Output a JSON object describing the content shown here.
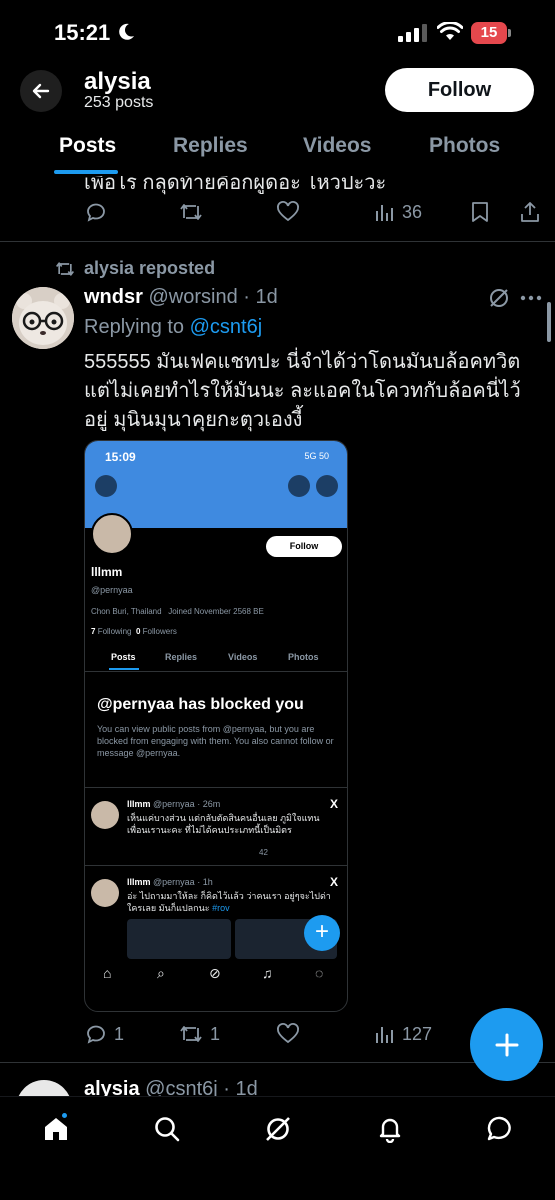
{
  "status_bar": {
    "time": "15:21",
    "battery": "15"
  },
  "header": {
    "name": "alysia",
    "post_count": "253 posts",
    "follow_label": "Follow"
  },
  "tabs": [
    "Posts",
    "Replies",
    "Videos",
    "Photos"
  ],
  "prev_post": {
    "text_fragment": "เพื่อไร กลุดท้ายคือกผูดอะ ไหวปะวะ",
    "views": "36"
  },
  "post": {
    "repost_label": "alysia reposted",
    "display_name": "wndsr",
    "handle_time": "@worsind · 1d",
    "replying_prefix": "Replying to ",
    "replying_mention": "@csnt6j",
    "text": "555555 มันเฟคแชทปะ นี่จำได้ว่าโดนมันบล้อคทวิตแต่ไม่เคยทำไรให้มันนะ ละแอคในโควทกับล้อคนี่ไว้อยู่ มุนินมุนาคุยกะตุวเองงี้",
    "replies": "1",
    "reposts": "1",
    "views": "127"
  },
  "embedded": {
    "time": "15:09",
    "status": "5G 50",
    "follow_label": "Follow",
    "name": "lllmm",
    "handle": "@pernyaa",
    "location": "Chon Buri, Thailand",
    "joined": "Joined November 2568 BE",
    "following_count": "7",
    "following_label": "Following",
    "followers_count": "0",
    "followers_label": "Followers",
    "tabs": [
      "Posts",
      "Replies",
      "Videos",
      "Photos"
    ],
    "blocked_title": "@pernyaa has blocked you",
    "blocked_body": "You can view public posts from @pernyaa, but you are blocked from engaging with them. You also cannot follow or message @pernyaa.",
    "post1": {
      "name": "lllmm",
      "meta": "@pernyaa · 26m",
      "text": "เห็นแค่บางส่วน แต่กลับตัดสินคนอื่นเลย ภูมิใจแทนเพื่อนเรานะคะ ที่ไม่ได้คนประเภทนี้เป็นมิตร",
      "views": "42"
    },
    "post2": {
      "name": "lllmm",
      "meta": "@pernyaa · 1h",
      "text": "อ่ะ ไปถามมาให้ละ ก็คิดไว้แล้ว ว่าคนเรา อยู่ๆจะไปด่าใครเลย มันก็แปลกนะ ",
      "tag": "#rov"
    }
  },
  "next_post": {
    "display_name": "alysia",
    "handle_time": "@csnt6j · 1d"
  },
  "icons": {
    "back": "back-arrow-icon",
    "reply": "reply-icon",
    "repost": "repost-icon",
    "like": "heart-icon",
    "views": "views-icon",
    "bookmark": "bookmark-icon",
    "share": "share-icon",
    "grok": "grok-icon",
    "more": "more-icon",
    "compose": "plus-icon",
    "nav": [
      "home-icon",
      "search-icon",
      "grok-icon",
      "bell-icon",
      "messages-icon"
    ]
  },
  "colors": {
    "accent": "#1d9bf0",
    "background": "#000000",
    "muted": "#8b98a5",
    "battery": "#e5484d"
  }
}
